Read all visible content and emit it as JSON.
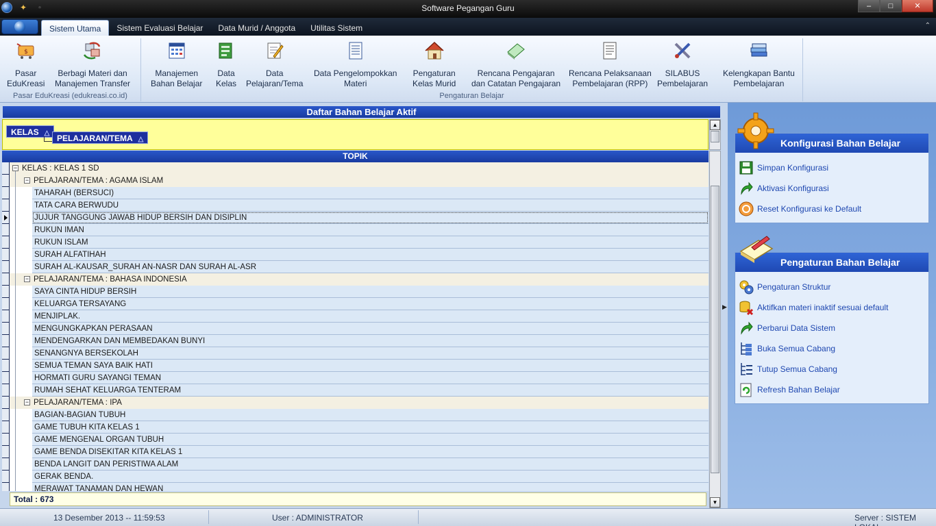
{
  "window": {
    "title": "Software Pegangan Guru",
    "controls": {
      "minimize": "–",
      "maximize": "□",
      "close": "✕"
    }
  },
  "ribbon_tabs": [
    {
      "label": "Sistem Utama",
      "active": true
    },
    {
      "label": "Sistem Evaluasi Belajar"
    },
    {
      "label": "Data Murid / Anggota"
    },
    {
      "label": "Utilitas Sistem"
    }
  ],
  "ribbon_collapse": "⌃",
  "ribbon": {
    "groups": [
      {
        "title": "Pasar EduKreasi (edukreasi.co.id)",
        "buttons": [
          {
            "line1": "Pasar",
            "line2": "EduKreasi",
            "icon": "cart-tag-icon"
          },
          {
            "line1": "Berbagi Materi dan",
            "line2": "Manajemen Transfer",
            "icon": "share-transfer-icon"
          }
        ]
      },
      {
        "title": "Pengaturan Belajar",
        "buttons": [
          {
            "line1": "Manajemen",
            "line2": "Bahan Belajar",
            "icon": "grid-calendar-icon"
          },
          {
            "line1": "Data",
            "line2": "Kelas",
            "icon": "class-data-icon"
          },
          {
            "line1": "Data",
            "line2": "Pelajaran/Tema",
            "icon": "pencil-note-icon"
          },
          {
            "line1": "Data Pengelompokkan",
            "line2": "Materi",
            "icon": "list-document-icon"
          },
          {
            "line1": "Pengaturan",
            "line2": "Kelas Murid",
            "icon": "house-icon"
          },
          {
            "line1": "Rencana Pengajaran",
            "line2": "dan Catatan Pengajaran",
            "icon": "notebook-icon"
          },
          {
            "line1": "Rencana Pelaksanaan",
            "line2": "Pembelajaran (RPP)",
            "icon": "lined-document-icon"
          },
          {
            "line1": "SILABUS",
            "line2": "Pembelajaran",
            "icon": "tools-icon"
          },
          {
            "line1": "Kelengkapan Bantu",
            "line2": "Pembelajaran",
            "icon": "book-stack-icon"
          }
        ]
      }
    ]
  },
  "main": {
    "title": "Daftar Bahan Belajar Aktif",
    "group_chips": [
      {
        "label": "KELAS",
        "sort": "△"
      },
      {
        "label": "PELAJARAN/TEMA",
        "sort": "△"
      }
    ],
    "column_header": "TOPIK",
    "tree": {
      "kelas": "KELAS : KELAS 1 SD",
      "subjects": [
        {
          "label": "PELAJARAN/TEMA : AGAMA ISLAM",
          "topics": [
            "TAHARAH (BERSUCI)",
            "TATA CARA BERWUDU",
            "JUJUR TANGGUNG JAWAB HIDUP BERSIH DAN DISIPLIN",
            "RUKUN IMAN",
            "RUKUN ISLAM",
            "SURAH ALFATIHAH",
            "SURAH AL-KAUSAR_SURAH AN-NASR DAN SURAH AL-ASR"
          ]
        },
        {
          "label": "PELAJARAN/TEMA : BAHASA INDONESIA",
          "topics": [
            "SAYA CINTA HIDUP BERSIH",
            "KELUARGA TERSAYANG",
            "MENJIPLAK.",
            "MENGUNGKAPKAN PERASAAN",
            "MENDENGARKAN DAN MEMBEDAKAN BUNYI",
            "SENANGNYA BERSEKOLAH",
            "SEMUA TEMAN SAYA BAIK HATI",
            "HORMATI GURU SAYANGI TEMAN",
            "RUMAH SEHAT KELUARGA TENTERAM"
          ]
        },
        {
          "label": "PELAJARAN/TEMA : IPA",
          "topics": [
            "BAGIAN-BAGIAN TUBUH",
            "GAME TUBUH KITA KELAS 1",
            "GAME MENGENAL  ORGAN TUBUH",
            "GAME BENDA DISEKITAR KITA KELAS 1",
            "BENDA LANGIT DAN PERISTIWA ALAM",
            "GERAK BENDA.",
            "MERAWAT TANAMAN DAN HEWAN"
          ]
        }
      ]
    },
    "current_topic": "JUJUR TANGGUNG JAWAB HIDUP BERSIH DAN DISIPLIN",
    "total": "Total  : 673"
  },
  "side": {
    "konfigurasi": {
      "title": "Konfigurasi Bahan Belajar",
      "items": [
        {
          "label": "Simpan Konfigurasi",
          "icon": "floppy-disk-icon"
        },
        {
          "label": "Aktivasi Konfigurasi",
          "icon": "green-arrow-icon"
        },
        {
          "label": "Reset Konfigurasi ke Default",
          "icon": "reset-circle-icon"
        }
      ]
    },
    "pengaturan": {
      "title": "Pengaturan Bahan Belajar",
      "items": [
        {
          "label": "Pengaturan Struktur",
          "icon": "gears-icon"
        },
        {
          "label": "Aktifkan materi inaktif sesuai default",
          "icon": "database-icon"
        },
        {
          "label": "Perbarui Data Sistem",
          "icon": "green-arrow-icon"
        },
        {
          "label": "Buka Semua Cabang",
          "icon": "tree-expand-icon"
        },
        {
          "label": "Tutup Semua Cabang",
          "icon": "tree-collapse-icon"
        },
        {
          "label": "Refresh Bahan Belajar",
          "icon": "refresh-icon"
        }
      ]
    }
  },
  "status": {
    "datetime": "13 Desember 2013 -- 11:59:53",
    "user": "User : ADMINISTRATOR",
    "server": "Server : SISTEM LOKAL"
  },
  "colors": {
    "accent": "#1f49b3",
    "group_bar": "#ffff9a",
    "leaf_row": "#dbe8f6"
  }
}
